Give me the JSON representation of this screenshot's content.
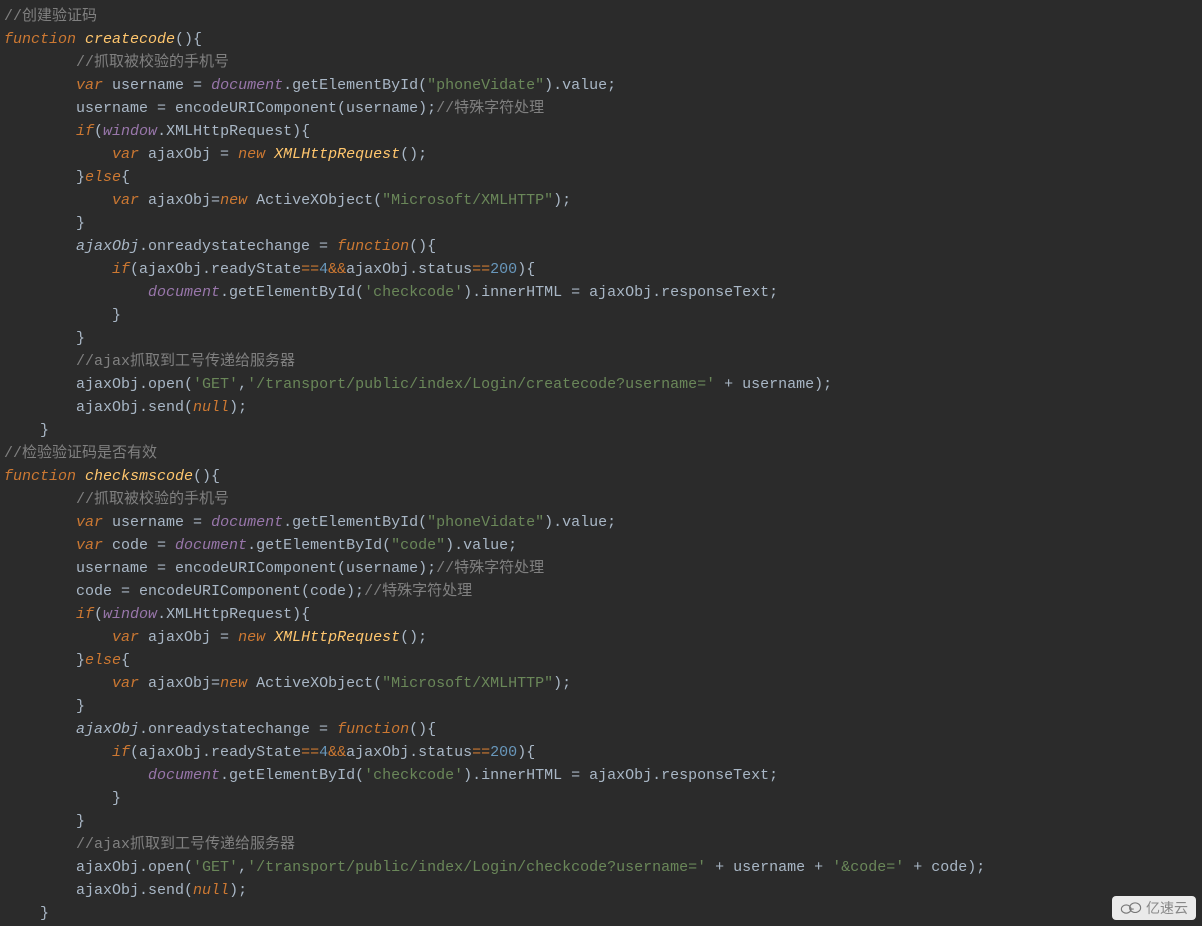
{
  "watermark": {
    "text": "亿速云"
  },
  "code": {
    "lines": [
      {
        "indent": 0,
        "tokens": [
          {
            "c": "cm",
            "t": "//创建验证码"
          }
        ]
      },
      {
        "indent": 0,
        "tokens": [
          {
            "c": "kw",
            "t": "function "
          },
          {
            "c": "fn",
            "t": "createcode"
          },
          {
            "c": "pl",
            "t": "(){"
          }
        ]
      },
      {
        "indent": 2,
        "tokens": [
          {
            "c": "cm",
            "t": "//抓取被校验的手机号"
          }
        ]
      },
      {
        "indent": 2,
        "tokens": [
          {
            "c": "kw",
            "t": "var "
          },
          {
            "c": "id",
            "t": "username = "
          },
          {
            "c": "doc",
            "t": "document"
          },
          {
            "c": "id",
            "t": ".getElementById("
          },
          {
            "c": "str",
            "t": "\"phoneVidate\""
          },
          {
            "c": "id",
            "t": ").value;"
          }
        ]
      },
      {
        "indent": 2,
        "tokens": [
          {
            "c": "id",
            "t": "username = encodeURIComponent(username);"
          },
          {
            "c": "cm",
            "t": "//特殊字符处理"
          }
        ]
      },
      {
        "indent": 2,
        "tokens": [
          {
            "c": "kw",
            "t": "if"
          },
          {
            "c": "pl",
            "t": "("
          },
          {
            "c": "obj",
            "t": "window"
          },
          {
            "c": "pl",
            "t": ".XMLHttpRequest){"
          }
        ]
      },
      {
        "indent": 3,
        "tokens": [
          {
            "c": "kw",
            "t": "var "
          },
          {
            "c": "id",
            "t": "ajaxObj = "
          },
          {
            "c": "kw",
            "t": "new "
          },
          {
            "c": "fn",
            "t": "XMLHttpRequest"
          },
          {
            "c": "pl",
            "t": "();"
          }
        ]
      },
      {
        "indent": 2,
        "tokens": [
          {
            "c": "pl",
            "t": "}"
          },
          {
            "c": "kw",
            "t": "else"
          },
          {
            "c": "pl",
            "t": "{"
          }
        ]
      },
      {
        "indent": 3,
        "tokens": [
          {
            "c": "kw",
            "t": "var "
          },
          {
            "c": "id",
            "t": "ajaxObj="
          },
          {
            "c": "kw",
            "t": "new "
          },
          {
            "c": "id",
            "t": "ActiveXObject("
          },
          {
            "c": "str",
            "t": "\"Microsoft/XMLHTTP\""
          },
          {
            "c": "pl",
            "t": ");"
          }
        ]
      },
      {
        "indent": 2,
        "tokens": [
          {
            "c": "pl",
            "t": "}"
          }
        ]
      },
      {
        "indent": 2,
        "tokens": [
          {
            "c": "var2",
            "t": "ajaxObj"
          },
          {
            "c": "id",
            "t": ".onreadystatechange = "
          },
          {
            "c": "kw",
            "t": "function"
          },
          {
            "c": "pl",
            "t": "(){"
          }
        ]
      },
      {
        "indent": 3,
        "tokens": [
          {
            "c": "kw",
            "t": "if"
          },
          {
            "c": "pl",
            "t": "(ajaxObj.readyState"
          },
          {
            "c": "op",
            "t": "=="
          },
          {
            "c": "num",
            "t": "4"
          },
          {
            "c": "op",
            "t": "&&"
          },
          {
            "c": "pl",
            "t": "ajaxObj.status"
          },
          {
            "c": "op",
            "t": "=="
          },
          {
            "c": "num",
            "t": "200"
          },
          {
            "c": "pl",
            "t": "){"
          }
        ]
      },
      {
        "indent": 4,
        "tokens": [
          {
            "c": "doc",
            "t": "document"
          },
          {
            "c": "id",
            "t": ".getElementById("
          },
          {
            "c": "str",
            "t": "'checkcode'"
          },
          {
            "c": "id",
            "t": ").innerHTML = ajaxObj.responseText;"
          }
        ]
      },
      {
        "indent": 3,
        "tokens": [
          {
            "c": "pl",
            "t": "}"
          }
        ]
      },
      {
        "indent": 2,
        "tokens": [
          {
            "c": "pl",
            "t": "}"
          }
        ]
      },
      {
        "indent": 2,
        "tokens": [
          {
            "c": "cm",
            "t": "//ajax抓取到工号传递给服务器"
          }
        ]
      },
      {
        "indent": 2,
        "tokens": [
          {
            "c": "id",
            "t": "ajaxObj.open("
          },
          {
            "c": "str",
            "t": "'GET'"
          },
          {
            "c": "pl",
            "t": ","
          },
          {
            "c": "str",
            "t": "'/transport/public/index/Login/createcode?username=' "
          },
          {
            "c": "pl",
            "t": "+ username);"
          }
        ]
      },
      {
        "indent": 2,
        "tokens": [
          {
            "c": "id",
            "t": "ajaxObj.send("
          },
          {
            "c": "kw",
            "t": "null"
          },
          {
            "c": "pl",
            "t": ");"
          }
        ]
      },
      {
        "indent": 1,
        "tokens": [
          {
            "c": "pl",
            "t": "}"
          }
        ]
      },
      {
        "indent": 0,
        "tokens": [
          {
            "c": "cm",
            "t": "//检验验证码是否有效"
          }
        ]
      },
      {
        "indent": 0,
        "tokens": [
          {
            "c": "kw",
            "t": "function "
          },
          {
            "c": "fn",
            "t": "checksmscode"
          },
          {
            "c": "pl",
            "t": "(){"
          }
        ]
      },
      {
        "indent": 2,
        "tokens": [
          {
            "c": "cm",
            "t": "//抓取被校验的手机号"
          }
        ]
      },
      {
        "indent": 2,
        "tokens": [
          {
            "c": "kw",
            "t": "var "
          },
          {
            "c": "id",
            "t": "username = "
          },
          {
            "c": "doc",
            "t": "document"
          },
          {
            "c": "id",
            "t": ".getElementById("
          },
          {
            "c": "str",
            "t": "\"phoneVidate\""
          },
          {
            "c": "id",
            "t": ").value;"
          }
        ]
      },
      {
        "indent": 2,
        "tokens": [
          {
            "c": "kw",
            "t": "var "
          },
          {
            "c": "id",
            "t": "code = "
          },
          {
            "c": "doc",
            "t": "document"
          },
          {
            "c": "id",
            "t": ".getElementById("
          },
          {
            "c": "str",
            "t": "\"code\""
          },
          {
            "c": "id",
            "t": ").value;"
          }
        ]
      },
      {
        "indent": 2,
        "tokens": [
          {
            "c": "id",
            "t": "username = encodeURIComponent(username);"
          },
          {
            "c": "cm",
            "t": "//特殊字符处理"
          }
        ]
      },
      {
        "indent": 2,
        "tokens": [
          {
            "c": "id",
            "t": "code = encodeURIComponent(code);"
          },
          {
            "c": "cm",
            "t": "//特殊字符处理"
          }
        ]
      },
      {
        "indent": 2,
        "tokens": [
          {
            "c": "kw",
            "t": "if"
          },
          {
            "c": "pl",
            "t": "("
          },
          {
            "c": "obj",
            "t": "window"
          },
          {
            "c": "pl",
            "t": ".XMLHttpRequest){"
          }
        ]
      },
      {
        "indent": 3,
        "tokens": [
          {
            "c": "kw",
            "t": "var "
          },
          {
            "c": "id",
            "t": "ajaxObj = "
          },
          {
            "c": "kw",
            "t": "new "
          },
          {
            "c": "fn",
            "t": "XMLHttpRequest"
          },
          {
            "c": "pl",
            "t": "();"
          }
        ]
      },
      {
        "indent": 2,
        "tokens": [
          {
            "c": "pl",
            "t": "}"
          },
          {
            "c": "kw",
            "t": "else"
          },
          {
            "c": "pl",
            "t": "{"
          }
        ]
      },
      {
        "indent": 3,
        "tokens": [
          {
            "c": "kw",
            "t": "var "
          },
          {
            "c": "id",
            "t": "ajaxObj="
          },
          {
            "c": "kw",
            "t": "new "
          },
          {
            "c": "id",
            "t": "ActiveXObject("
          },
          {
            "c": "str",
            "t": "\"Microsoft/XMLHTTP\""
          },
          {
            "c": "pl",
            "t": ");"
          }
        ]
      },
      {
        "indent": 2,
        "tokens": [
          {
            "c": "pl",
            "t": "}"
          }
        ]
      },
      {
        "indent": 2,
        "tokens": [
          {
            "c": "var2",
            "t": "ajaxObj"
          },
          {
            "c": "id",
            "t": ".onreadystatechange = "
          },
          {
            "c": "kw",
            "t": "function"
          },
          {
            "c": "pl",
            "t": "(){"
          }
        ]
      },
      {
        "indent": 3,
        "tokens": [
          {
            "c": "kw",
            "t": "if"
          },
          {
            "c": "pl",
            "t": "(ajaxObj.readyState"
          },
          {
            "c": "op",
            "t": "=="
          },
          {
            "c": "num",
            "t": "4"
          },
          {
            "c": "op",
            "t": "&&"
          },
          {
            "c": "pl",
            "t": "ajaxObj.status"
          },
          {
            "c": "op",
            "t": "=="
          },
          {
            "c": "num",
            "t": "200"
          },
          {
            "c": "pl",
            "t": "){"
          }
        ]
      },
      {
        "indent": 4,
        "tokens": [
          {
            "c": "doc",
            "t": "document"
          },
          {
            "c": "id",
            "t": ".getElementById("
          },
          {
            "c": "str",
            "t": "'checkcode'"
          },
          {
            "c": "id",
            "t": ").innerHTML = ajaxObj.responseText;"
          }
        ]
      },
      {
        "indent": 3,
        "tokens": [
          {
            "c": "pl",
            "t": "}"
          }
        ]
      },
      {
        "indent": 2,
        "tokens": [
          {
            "c": "pl",
            "t": "}"
          }
        ]
      },
      {
        "indent": 2,
        "tokens": [
          {
            "c": "cm",
            "t": "//ajax抓取到工号传递给服务器"
          }
        ]
      },
      {
        "indent": 2,
        "tokens": [
          {
            "c": "id",
            "t": "ajaxObj.open("
          },
          {
            "c": "str",
            "t": "'GET'"
          },
          {
            "c": "pl",
            "t": ","
          },
          {
            "c": "str",
            "t": "'/transport/public/index/Login/checkcode?username=' "
          },
          {
            "c": "pl",
            "t": "+ username + "
          },
          {
            "c": "str",
            "t": "'&code=' "
          },
          {
            "c": "pl",
            "t": "+ code);"
          }
        ]
      },
      {
        "indent": 2,
        "tokens": [
          {
            "c": "id",
            "t": "ajaxObj.send("
          },
          {
            "c": "kw",
            "t": "null"
          },
          {
            "c": "pl",
            "t": ");"
          }
        ]
      },
      {
        "indent": 1,
        "tokens": [
          {
            "c": "pl",
            "t": "}"
          }
        ]
      }
    ]
  }
}
